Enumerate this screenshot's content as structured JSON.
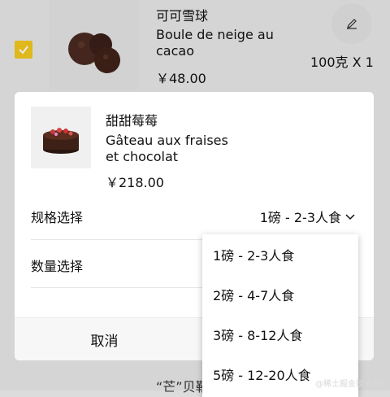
{
  "background_item": {
    "name": "可可雪球",
    "name_fr": "Boule de neige au cacao",
    "price": "￥48.00",
    "quantity": "100克 X 1",
    "next_item_partial": "“芒”贝勒",
    "checked": true
  },
  "modal": {
    "product_name": "甜甜莓莓",
    "product_name_fr": "Gâteau aux fraises et chocolat",
    "price": "￥218.00",
    "spec_label": "规格选择",
    "spec_value": "1磅 - 2-3人食",
    "quantity_label": "数量选择",
    "cancel_label": "取消"
  },
  "dropdown": {
    "options": [
      "1磅 - 2-3人食",
      "2磅 - 4-7人食",
      "3磅 - 8-12人食",
      "5磅 - 12-20人食"
    ]
  },
  "watermark": "@稀土掘金技术社区",
  "colors": {
    "checkbox": "#f2c81e",
    "modal_bg": "#ffffff",
    "page_bg": "#e8e8e8"
  },
  "icons": [
    "checkmark-icon",
    "pencil-icon",
    "chevron-down-icon"
  ]
}
